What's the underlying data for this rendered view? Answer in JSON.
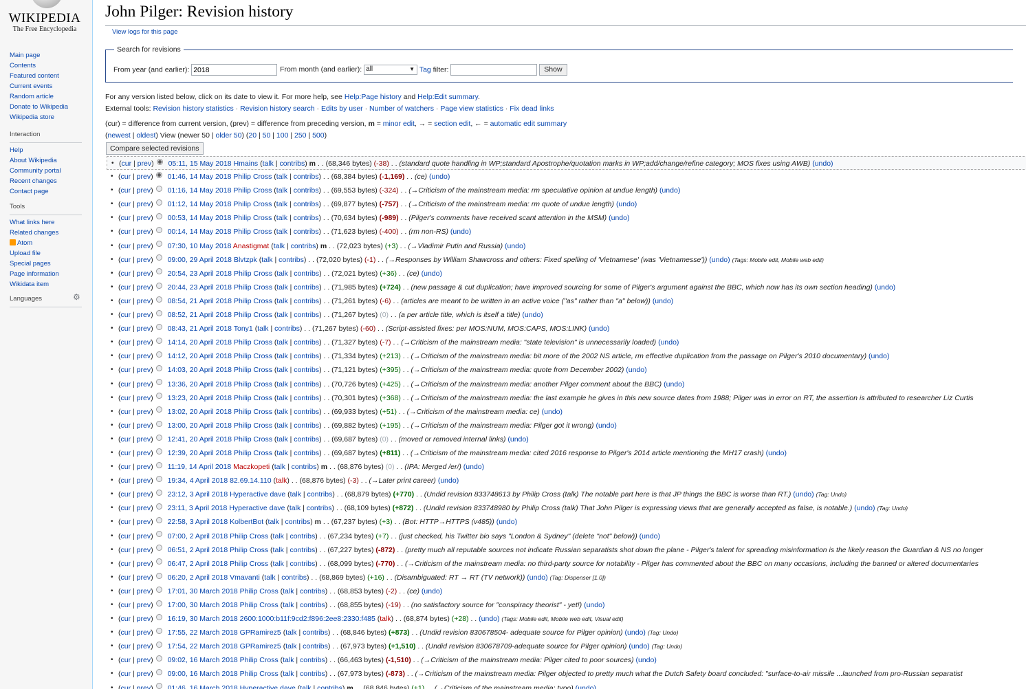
{
  "sidebar": {
    "logo_title": "Wikipedia",
    "logo_tagline": "The Free Encyclopedia",
    "navigation": [
      "Main page",
      "Contents",
      "Featured content",
      "Current events",
      "Random article",
      "Donate to Wikipedia",
      "Wikipedia store"
    ],
    "interaction_heading": "Interaction",
    "interaction": [
      "Help",
      "About Wikipedia",
      "Community portal",
      "Recent changes",
      "Contact page"
    ],
    "tools_heading": "Tools",
    "tools": [
      "What links here",
      "Related changes",
      "Atom",
      "Upload file",
      "Special pages",
      "Page information",
      "Wikidata item"
    ],
    "languages_heading": "Languages"
  },
  "page": {
    "title": "John Pilger: Revision history",
    "view_logs": "View logs for this page"
  },
  "search": {
    "legend": "Search for revisions",
    "year_label": "From year (and earlier):",
    "year_value": "2018",
    "month_label": "From month (and earlier):",
    "month_value": "all",
    "tag_link": "Tag",
    "tag_label": " filter:",
    "tag_value": "",
    "show_button": "Show"
  },
  "help": {
    "intro": "For any version listed below, click on its date to view it. For more help, see ",
    "page_history_link": "Help:Page history",
    "and": " and ",
    "edit_summary_link": "Help:Edit summary",
    "end": ".",
    "external_label": "External tools: ",
    "external_tools": [
      "Revision history statistics",
      "Revision history search",
      "Edits by user",
      "Number of watchers",
      "Page view statistics",
      "Fix dead links"
    ]
  },
  "legend_line": {
    "text1": "(cur) = difference from current version, (prev) = difference from preceding version, ",
    "minor_marker": "m",
    "text2": " = ",
    "minor_link": "minor edit",
    "text3": ", → = ",
    "section_link": "section edit",
    "text4": ", ← = ",
    "auto_link": "automatic edit summary"
  },
  "paging": {
    "open": "(",
    "newest": "newest",
    "pipe": " | ",
    "oldest": "oldest",
    "mid": ") View (newer 50 | ",
    "older": "older 50",
    "mid2": ") (",
    "n20": "20",
    "n50": "50",
    "n100": "100",
    "n250": "250",
    "n500": "500",
    "close": ")"
  },
  "compare_button": "Compare selected revisions",
  "revisions": [
    {
      "date": "05:11, 15 May 2018",
      "user": "Hmains",
      "minor": true,
      "bytes": "(68,346 bytes)",
      "diff": "(-38)",
      "summary": "(standard quote handling in WP;standard Apostrophe/quotation marks in WP;add/change/refine category; MOS fixes using AWB)",
      "undo": "(undo)"
    },
    {
      "date": "01:46, 14 May 2018",
      "user": "Philip Cross",
      "minor": false,
      "bytes": "(68,384 bytes)",
      "diff": "(-1,169)",
      "summary": "(ce)",
      "undo": "(undo)"
    },
    {
      "date": "01:16, 14 May 2018",
      "user": "Philip Cross",
      "minor": false,
      "bytes": "(69,553 bytes)",
      "diff": "(-324)",
      "summary": "(→Criticism of the mainstream media: rm speculative opinion at undue length)",
      "undo": "(undo)"
    },
    {
      "date": "01:12, 14 May 2018",
      "user": "Philip Cross",
      "minor": false,
      "bytes": "(69,877 bytes)",
      "diff": "(-757)",
      "summary": "(→Criticism of the mainstream media: rm quote of undue length)",
      "undo": "(undo)"
    },
    {
      "date": "00:53, 14 May 2018",
      "user": "Philip Cross",
      "minor": false,
      "bytes": "(70,634 bytes)",
      "diff": "(-989)",
      "summary": "(Pilger's comments have received scant attention in the MSM)",
      "undo": "(undo)"
    },
    {
      "date": "00:14, 14 May 2018",
      "user": "Philip Cross",
      "minor": false,
      "bytes": "(71,623 bytes)",
      "diff": "(-400)",
      "summary": "(rm non-RS)",
      "undo": "(undo)"
    },
    {
      "date": "07:30, 10 May 2018",
      "user": "Anastigmat",
      "minor": true,
      "bytes": "(72,023 bytes)",
      "diff": "(+3)",
      "summary": "(→Vladimir Putin and Russia)",
      "undo": "(undo)"
    },
    {
      "date": "09:00, 29 April 2018",
      "user": "Blvtzpk",
      "minor": false,
      "bytes": "(72,020 bytes)",
      "diff": "(-1)",
      "summary": "(→Responses by William Shawcross and others: Fixed spelling of 'Vietnamese' (was 'Vietnamesse'))",
      "undo": "(undo)",
      "tags": "(Tags: Mobile edit, Mobile web edit)"
    },
    {
      "date": "20:54, 23 April 2018",
      "user": "Philip Cross",
      "minor": false,
      "bytes": "(72,021 bytes)",
      "diff": "(+36)",
      "summary": "(ce)",
      "undo": "(undo)"
    },
    {
      "date": "20:44, 23 April 2018",
      "user": "Philip Cross",
      "minor": false,
      "bytes": "(71,985 bytes)",
      "diff": "(+724)",
      "summary": "(new passage & cut duplication; have improved sourcing for some of Pilger's argument against the BBC, which now has its own section heading)",
      "undo": "(undo)"
    },
    {
      "date": "08:54, 21 April 2018",
      "user": "Philip Cross",
      "minor": false,
      "bytes": "(71,261 bytes)",
      "diff": "(-6)",
      "summary": "(articles are meant to be written in an active voice (\"as\" rather than \"a\" below))",
      "undo": "(undo)"
    },
    {
      "date": "08:52, 21 April 2018",
      "user": "Philip Cross",
      "minor": false,
      "bytes": "(71,267 bytes)",
      "diff": "(0)",
      "summary": "(a per article title, which is itself a title)",
      "undo": "(undo)"
    },
    {
      "date": "08:43, 21 April 2018",
      "user": "Tony1",
      "minor": false,
      "bytes": "(71,267 bytes)",
      "diff": "(-60)",
      "summary": "(Script-assisted fixes: per MOS:NUM, MOS:CAPS, MOS:LINK)",
      "undo": "(undo)"
    },
    {
      "date": "14:14, 20 April 2018",
      "user": "Philip Cross",
      "minor": false,
      "bytes": "(71,327 bytes)",
      "diff": "(-7)",
      "summary": "(→Criticism of the mainstream media: \"state television\" is unnecessarily loaded)",
      "undo": "(undo)"
    },
    {
      "date": "14:12, 20 April 2018",
      "user": "Philip Cross",
      "minor": false,
      "bytes": "(71,334 bytes)",
      "diff": "(+213)",
      "summary": "(→Criticism of the mainstream media: bit more of the 2002 NS article, rm effective duplication from the passage on Pilger's 2010 documentary)",
      "undo": "(undo)"
    },
    {
      "date": "14:03, 20 April 2018",
      "user": "Philip Cross",
      "minor": false,
      "bytes": "(71,121 bytes)",
      "diff": "(+395)",
      "summary": "(→Criticism of the mainstream media: quote from December 2002)",
      "undo": "(undo)"
    },
    {
      "date": "13:36, 20 April 2018",
      "user": "Philip Cross",
      "minor": false,
      "bytes": "(70,726 bytes)",
      "diff": "(+425)",
      "summary": "(→Criticism of the mainstream media: another Pilger comment about the BBC)",
      "undo": "(undo)"
    },
    {
      "date": "13:23, 20 April 2018",
      "user": "Philip Cross",
      "minor": false,
      "bytes": "(70,301 bytes)",
      "diff": "(+368)",
      "summary": "(→Criticism of the mainstream media: the last example he gives in this new source dates from 1988; Pilger was in error on RT, the assertion is attributed to researcher Liz Curtis",
      "undo": ""
    },
    {
      "date": "13:02, 20 April 2018",
      "user": "Philip Cross",
      "minor": false,
      "bytes": "(69,933 bytes)",
      "diff": "(+51)",
      "summary": "(→Criticism of the mainstream media: ce)",
      "undo": "(undo)"
    },
    {
      "date": "13:00, 20 April 2018",
      "user": "Philip Cross",
      "minor": false,
      "bytes": "(69,882 bytes)",
      "diff": "(+195)",
      "summary": "(→Criticism of the mainstream media: Pilger got it wrong)",
      "undo": "(undo)"
    },
    {
      "date": "12:41, 20 April 2018",
      "user": "Philip Cross",
      "minor": false,
      "bytes": "(69,687 bytes)",
      "diff": "(0)",
      "summary": "(moved or removed internal links)",
      "undo": "(undo)"
    },
    {
      "date": "12:39, 20 April 2018",
      "user": "Philip Cross",
      "minor": false,
      "bytes": "(69,687 bytes)",
      "diff": "(+811)",
      "summary": "(→Criticism of the mainstream media: cited 2016 response to Pilger's 2014 article mentioning the MH17 crash)",
      "undo": "(undo)"
    },
    {
      "date": "11:19, 14 April 2018",
      "user": "Maczkopeti",
      "minor": true,
      "bytes": "(68,876 bytes)",
      "diff": "(0)",
      "summary": "(IPA: Merged /er/)",
      "undo": "(undo)"
    },
    {
      "date": "19:34, 4 April 2018",
      "user": "82.69.14.110",
      "minor": false,
      "bytes": "(68,876 bytes)",
      "diff": "(-3)",
      "summary": "(→Later print career)",
      "undo": "(undo)"
    },
    {
      "date": "23:12, 3 April 2018",
      "user": "Hyperactive dave",
      "minor": false,
      "bytes": "(68,879 bytes)",
      "diff": "(+770)",
      "summary": "(Undid revision 833748613 by Philip Cross (talk) The notable part here is that JP things the BBC is worse than RT.)",
      "undo": "(undo)",
      "tags": "(Tag: Undo)"
    },
    {
      "date": "23:11, 3 April 2018",
      "user": "Hyperactive dave",
      "minor": false,
      "bytes": "(68,109 bytes)",
      "diff": "(+872)",
      "summary": "(Undid revision 833748980 by Philip Cross (talk) That John Pilger is expressing views that are generally accepted as false, is notable.)",
      "undo": "(undo)",
      "tags": "(Tag: Undo)"
    },
    {
      "date": "22:58, 3 April 2018",
      "user": "KolbertBot",
      "minor": true,
      "bytes": "(67,237 bytes)",
      "diff": "(+3)",
      "summary": "(Bot: HTTP→HTTPS (v485))",
      "undo": "(undo)"
    },
    {
      "date": "07:00, 2 April 2018",
      "user": "Philip Cross",
      "minor": false,
      "bytes": "(67,234 bytes)",
      "diff": "(+7)",
      "summary": "(just checked, his Twitter bio says \"London & Sydney\" (delete \"not\" below))",
      "undo": "(undo)"
    },
    {
      "date": "06:51, 2 April 2018",
      "user": "Philip Cross",
      "minor": false,
      "bytes": "(67,227 bytes)",
      "diff": "(-872)",
      "summary": "(pretty much all reputable sources not indicate Russian separatists shot down the plane - Pilger's talent for spreading misinformation is the likely reason the Guardian & NS no longer",
      "undo": ""
    },
    {
      "date": "06:47, 2 April 2018",
      "user": "Philip Cross",
      "minor": false,
      "bytes": "(68,099 bytes)",
      "diff": "(-770)",
      "summary": "(→Criticism of the mainstream media: no third-party source for notability - Pilger has commented about the BBC on many occasions, including the banned or altered documentaries",
      "undo": ""
    },
    {
      "date": "06:20, 2 April 2018",
      "user": "Vmavanti",
      "minor": false,
      "bytes": "(68,869 bytes)",
      "diff": "(+16)",
      "summary": "(Disambiguated: RT → RT (TV network))",
      "undo": "(undo)",
      "tags": "(Tag: Dispenser [1.0])"
    },
    {
      "date": "17:01, 30 March 2018",
      "user": "Philip Cross",
      "minor": false,
      "bytes": "(68,853 bytes)",
      "diff": "(-2)",
      "summary": "(ce)",
      "undo": "(undo)"
    },
    {
      "date": "17:00, 30 March 2018",
      "user": "Philip Cross",
      "minor": false,
      "bytes": "(68,855 bytes)",
      "diff": "(-19)",
      "summary": "(no satisfactory source for \"conspiracy theorist\" - yet!)",
      "undo": "(undo)"
    },
    {
      "date": "16:19, 30 March 2018",
      "user": "2600:1000:b11f:9cd2:f896:2ee8:2330:f485",
      "minor": false,
      "bytes": "(68,874 bytes)",
      "diff": "(+28)",
      "summary": "",
      "undo": "(undo)",
      "tags": "(Tags: Mobile edit, Mobile web edit, Visual edit)"
    },
    {
      "date": "17:55, 22 March 2018",
      "user": "GPRamirez5",
      "minor": false,
      "bytes": "(68,846 bytes)",
      "diff": "(+873)",
      "summary": "(Undid revision 830678504- adequate source for Pilger opinion)",
      "undo": "(undo)",
      "tags": "(Tag: Undo)"
    },
    {
      "date": "17:54, 22 March 2018",
      "user": "GPRamirez5",
      "minor": false,
      "bytes": "(67,973 bytes)",
      "diff": "(+1,510)",
      "summary": "(Undid revision 830678709-adequate source for Pilger opinion)",
      "undo": "(undo)",
      "tags": "(Tag: Undo)"
    },
    {
      "date": "09:02, 16 March 2018",
      "user": "Philip Cross",
      "minor": false,
      "bytes": "(66,463 bytes)",
      "diff": "(-1,510)",
      "summary": "(→Criticism of the mainstream media: Pilger cited to poor sources)",
      "undo": "(undo)"
    },
    {
      "date": "09:00, 16 March 2018",
      "user": "Philip Cross",
      "minor": false,
      "bytes": "(67,973 bytes)",
      "diff": "(-873)",
      "summary": "(→Criticism of the mainstream media: Pilger objected to pretty much what the Dutch Safety board concluded: \"surface-to-air missile ...launched from pro-Russian separatist",
      "undo": ""
    },
    {
      "date": "01:46, 16 March 2018",
      "user": "Hyperactive dave",
      "minor": true,
      "bytes": "(68,846 bytes)",
      "diff": "(+1)",
      "summary": "(→Criticism of the mainstream media: typo)",
      "undo": "(undo)"
    }
  ],
  "row_text": {
    "cur": "cur",
    "prev": "prev",
    "talk": "talk",
    "contribs": "contribs",
    "minor": "m"
  }
}
